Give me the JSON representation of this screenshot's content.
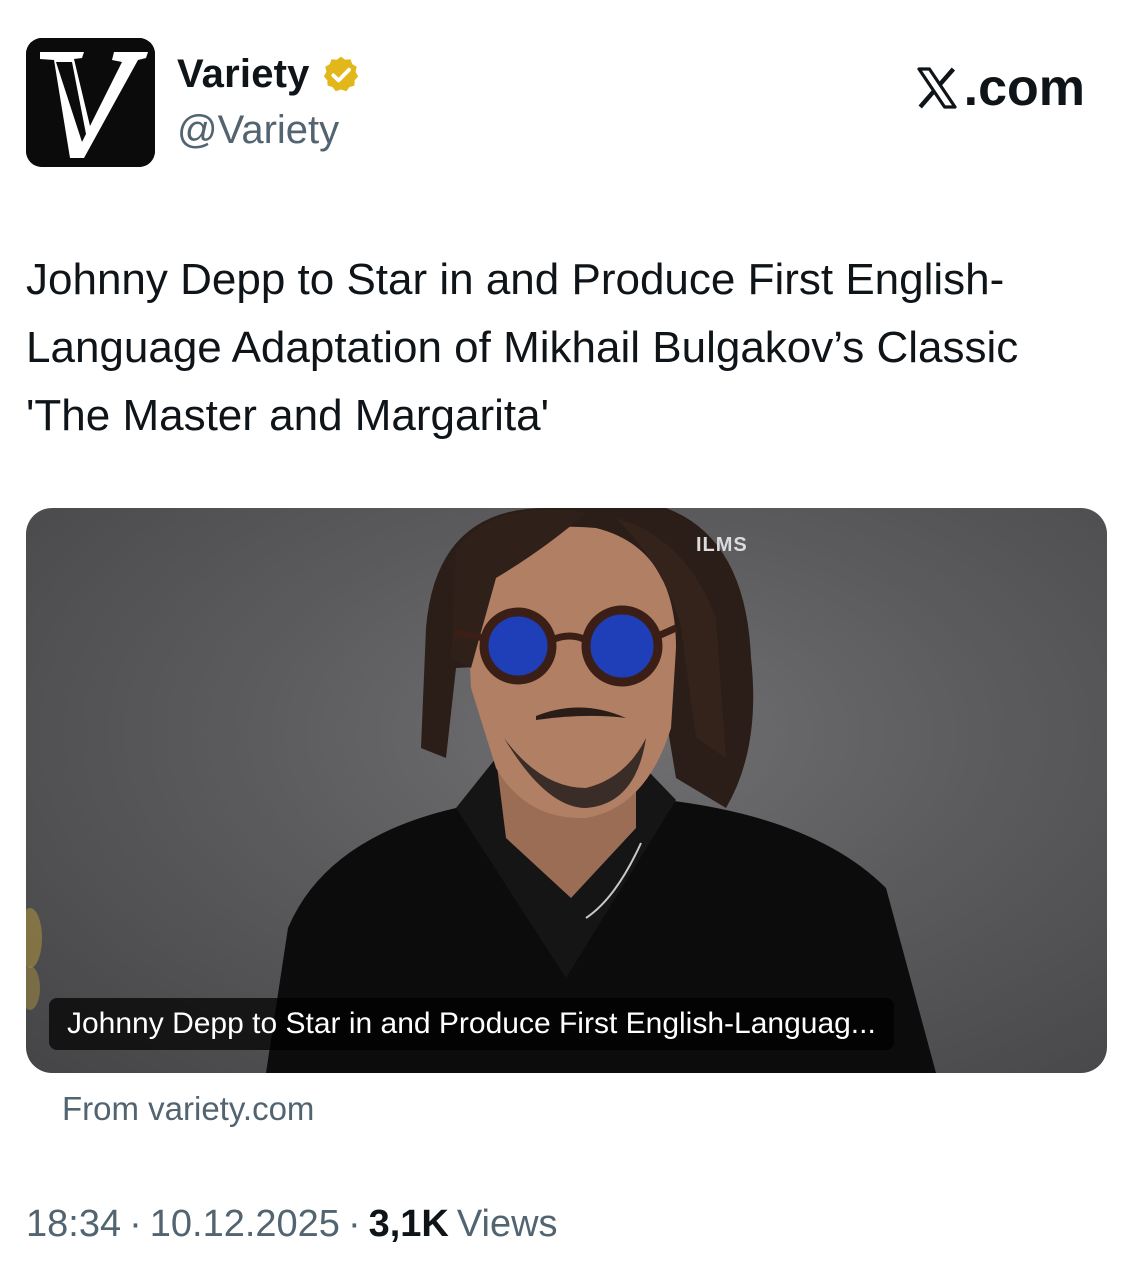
{
  "header": {
    "display_name": "Variety",
    "handle": "@Variety",
    "site_label": ".com",
    "avatar_icon": "variety-v-logo",
    "verified_icon": "verified-gold-badge",
    "verified_color": "#e2b719"
  },
  "tweet": {
    "text": "Johnny Depp to Star in and Produce First English-Language Adaptation of Mikhail Bulgakov’s Classic 'The Master and Margarita'"
  },
  "card": {
    "photo_sign": "ILMS",
    "caption": "Johnny Depp to Star in and Produce First English-Languag...",
    "source": "From variety.com"
  },
  "meta": {
    "time": "18:34",
    "separator": "·",
    "date": "10.12.2025",
    "views_count": "3,1K",
    "views_label": "Views"
  }
}
